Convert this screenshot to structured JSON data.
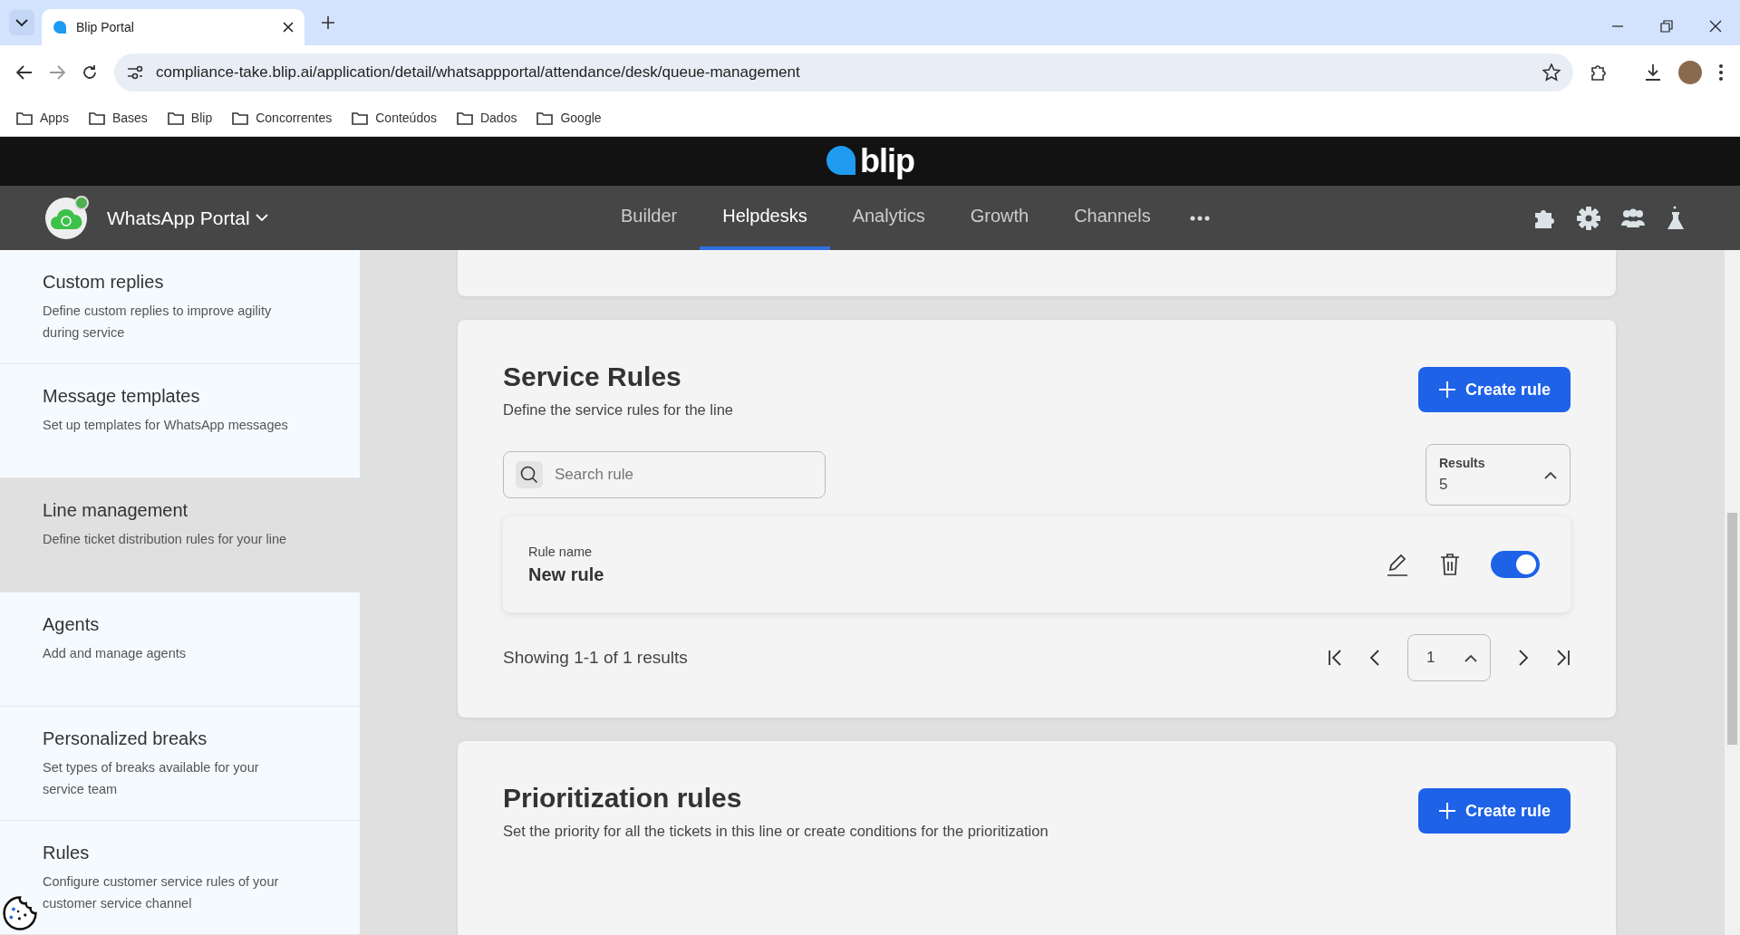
{
  "browser": {
    "tab_title": "Blip Portal",
    "url": "compliance-take.blip.ai/application/detail/whatsappportal/attendance/desk/queue-management",
    "bookmarks": [
      "Apps",
      "Bases",
      "Blip",
      "Concorrentes",
      "Conteúdos",
      "Dados",
      "Google"
    ]
  },
  "header": {
    "logo": "blip",
    "bot_name": "WhatsApp Portal",
    "nav": [
      {
        "label": "Builder",
        "selected": false
      },
      {
        "label": "Helpdesks",
        "selected": true
      },
      {
        "label": "Analytics",
        "selected": false
      },
      {
        "label": "Growth",
        "selected": false
      },
      {
        "label": "Channels",
        "selected": false
      }
    ]
  },
  "sidebar": {
    "items": [
      {
        "title": "Custom replies",
        "description": "Define custom replies to improve agility during service",
        "selected": false
      },
      {
        "title": "Message templates",
        "description": "Set up templates for WhatsApp messages",
        "selected": false
      },
      {
        "title": "Line management",
        "description": "Define ticket distribution rules for your line",
        "selected": true
      },
      {
        "title": "Agents",
        "description": "Add and manage agents",
        "selected": false
      },
      {
        "title": "Personalized breaks",
        "description": "Set types of breaks available for your service team",
        "selected": false
      },
      {
        "title": "Rules",
        "description": "Configure customer service rules of your customer service channel",
        "selected": false
      }
    ]
  },
  "service_rules": {
    "title": "Service Rules",
    "subtitle": "Define the service rules for the line",
    "create_button": "Create rule",
    "search": {
      "placeholder": "Search rule"
    },
    "results": {
      "label": "Results",
      "value": "5"
    },
    "rules": [
      {
        "label": "Rule name",
        "name": "New rule",
        "enabled": true
      }
    ],
    "summary": "Showing 1-1 of 1 results",
    "page": "1"
  },
  "prioritization_rules": {
    "title": "Prioritization rules",
    "subtitle": "Set the priority for all the tickets in this line or create conditions for the prioritization",
    "create_button": "Create rule"
  }
}
